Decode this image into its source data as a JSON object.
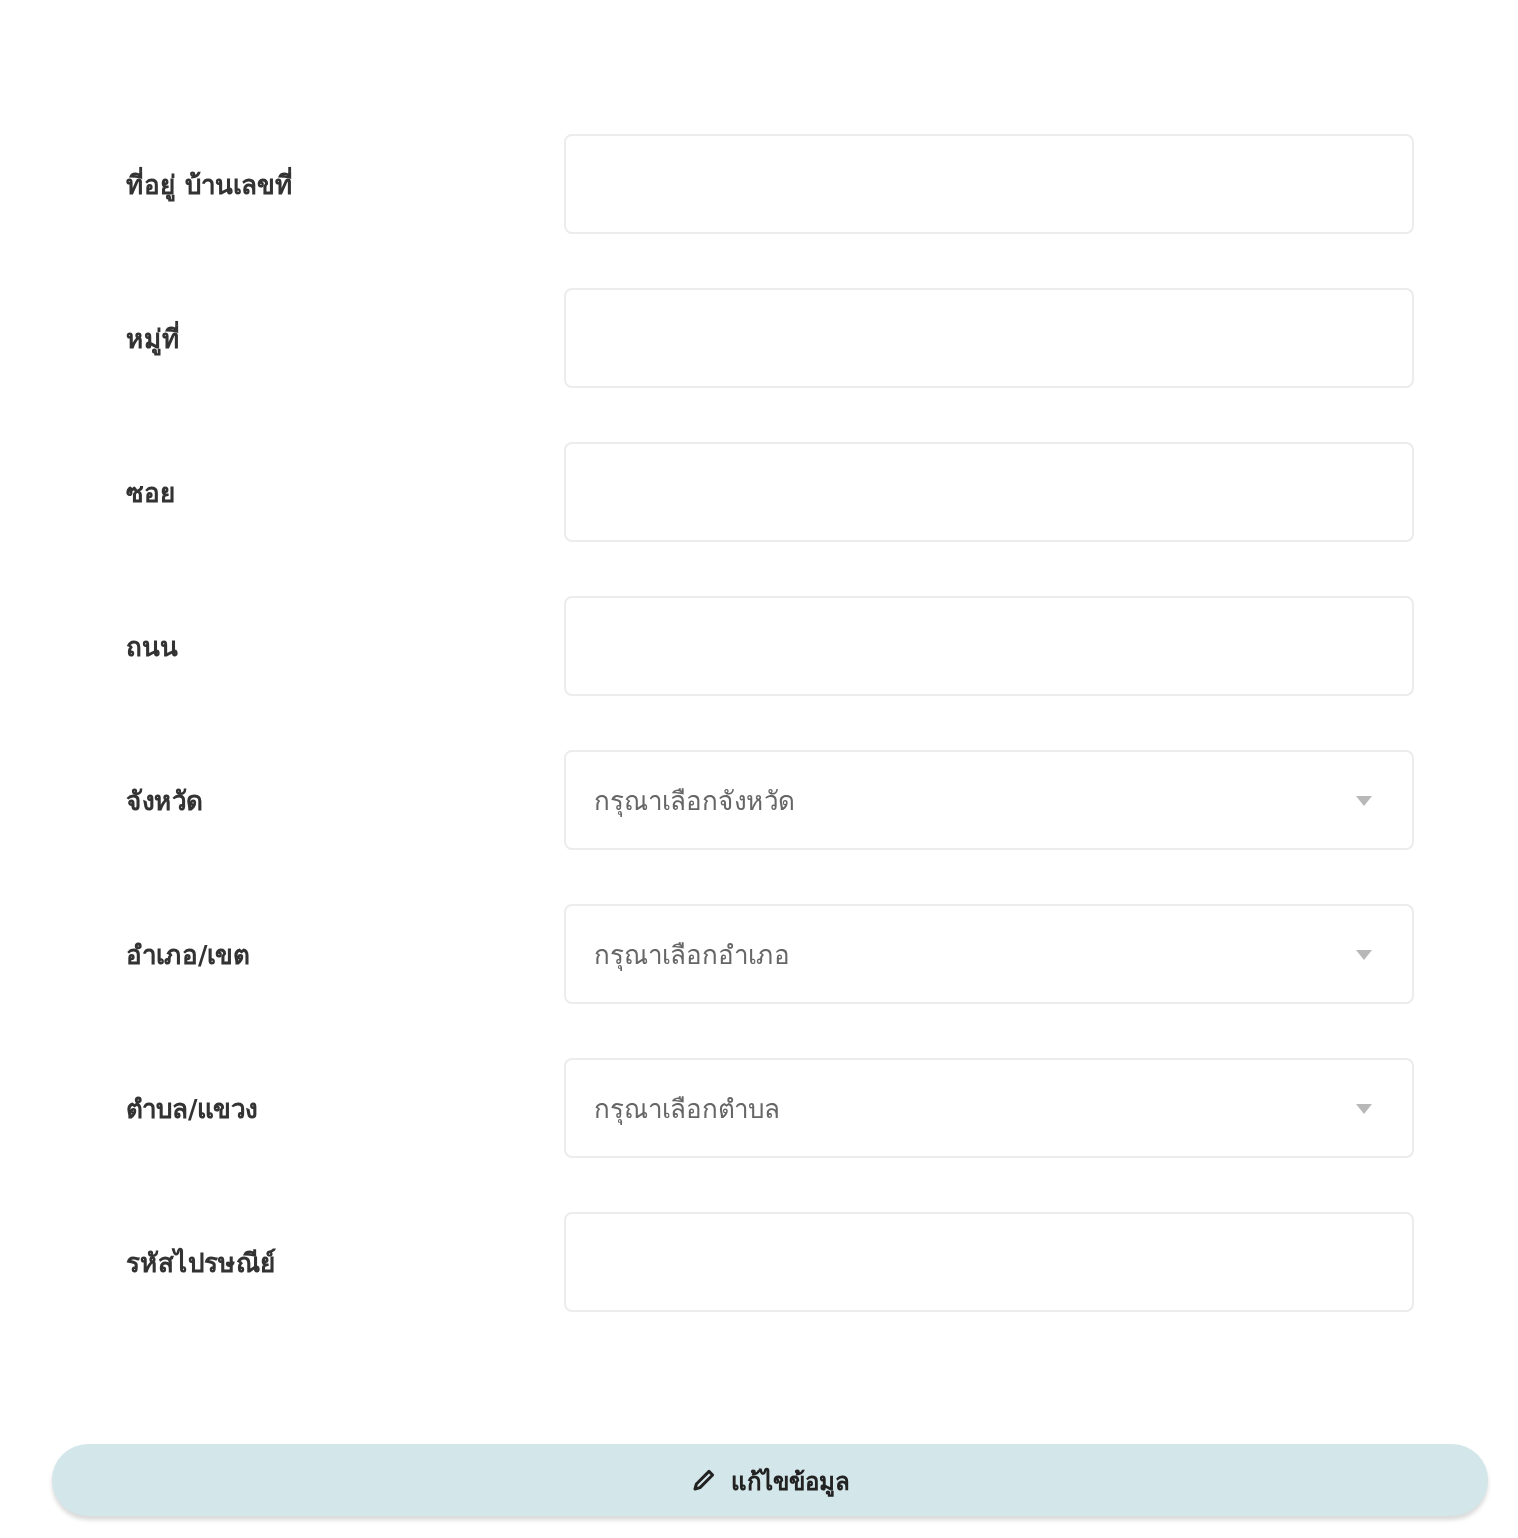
{
  "fields": [
    {
      "label": "ที่อยู่ บ้านเลขที่",
      "kind": "text"
    },
    {
      "label": "หมู่ที่",
      "kind": "text"
    },
    {
      "label": "ซอย",
      "kind": "text"
    },
    {
      "label": "ถนน",
      "kind": "text"
    },
    {
      "label": "จังหวัด",
      "kind": "select",
      "placeholder": "กรุณาเลือกจังหวัด"
    },
    {
      "label": "อำเภอ/เขต",
      "kind": "select",
      "placeholder": "กรุณาเลือกอำเภอ"
    },
    {
      "label": "ตำบล/แขวง",
      "kind": "select",
      "placeholder": "กรุณาเลือกตำบล"
    },
    {
      "label": "รหัสไปรษณีย์",
      "kind": "text"
    }
  ],
  "submit_button": {
    "label": "แก้ไขข้อมูล"
  }
}
